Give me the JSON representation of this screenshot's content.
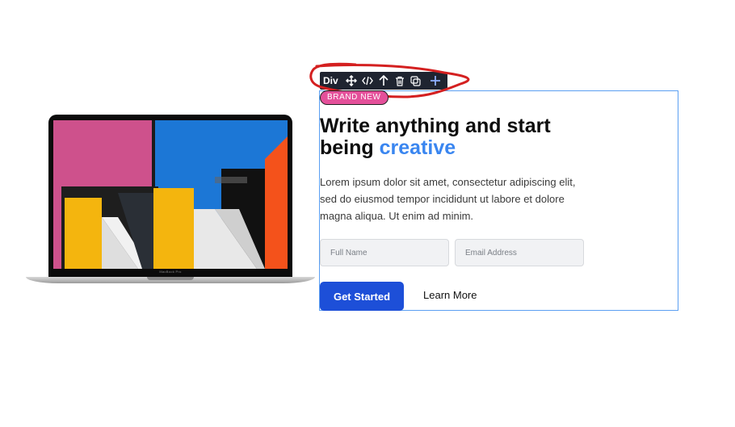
{
  "toolbar": {
    "element_label": "Div",
    "icons": [
      "move-icon",
      "code-icon",
      "arrow-up-icon",
      "trash-icon",
      "duplicate-icon",
      "plus-icon"
    ],
    "accent": "#1f2430"
  },
  "laptop": {
    "brand": "MacBook Pro"
  },
  "hero": {
    "badge": "BRAND NEW",
    "headline_part1": "Write anything and start being",
    "headline_accent": "creative",
    "body": "Lorem ipsum dolor sit amet, consectetur adipiscing elit, sed do eiusmod tempor incididunt ut labore et dolore magna aliqua. Ut enim ad minim.",
    "full_name_placeholder": "Full Name",
    "email_placeholder": "Email Address",
    "primary_button": "Get Started",
    "secondary_button": "Learn More"
  },
  "colors": {
    "badge": "#e4509a",
    "accent_text": "#3a86f0",
    "primary_button": "#1d4fd8",
    "selection_outline": "#5b9ff2",
    "annotation": "#d42020"
  }
}
